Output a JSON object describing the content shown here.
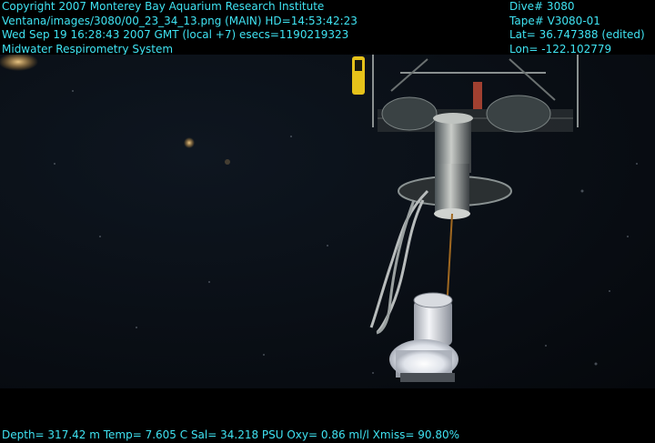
{
  "overlay": {
    "left_lines": [
      "Copyright 2007 Monterey Bay Aquarium Research Institute",
      "Ventana/images/3080/00_23_34_13.png (MAIN)  HD=14:53:42:23",
      "Wed Sep 19 16:28:43 2007 GMT (local +7)  esecs=1190219323",
      "Midwater Respirometry System"
    ],
    "right_lines": [
      "Dive# 3080",
      "Tape# V3080-01",
      "Lat= 36.747388 (edited)",
      "Lon= -122.102779"
    ],
    "bottom_line": "Depth= 317.42 m  Temp= 7.605 C  Sal= 34.218 PSU  Oxy= 0.86 ml/l  Xmiss= 90.80%"
  },
  "colors": {
    "overlay_text": "#3fe3f2",
    "water": "#0a0f16",
    "frame": "#000000"
  }
}
